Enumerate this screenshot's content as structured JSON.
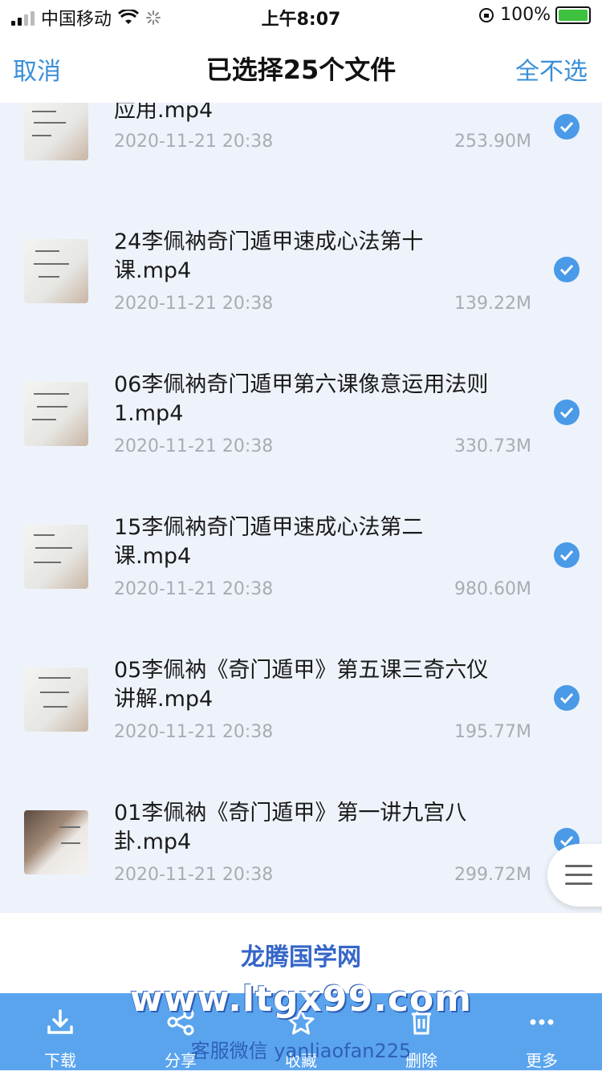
{
  "status": {
    "carrier": "中国移动",
    "time": "上午8:07",
    "battery": "100%"
  },
  "nav": {
    "cancel": "取消",
    "title": "已选择25个文件",
    "deselect_all": "全不选"
  },
  "files": [
    {
      "name": "应用.mp4",
      "date": "2020-11-21 20:38",
      "size": "253.90M",
      "checked": true
    },
    {
      "name": "24李佩衲奇门遁甲速成心法第十课.mp4",
      "date": "2020-11-21 20:38",
      "size": "139.22M",
      "checked": true
    },
    {
      "name": "06李佩衲奇门遁甲第六课像意运用法则1.mp4",
      "date": "2020-11-21 20:38",
      "size": "330.73M",
      "checked": true
    },
    {
      "name": "15李佩衲奇门遁甲速成心法第二课.mp4",
      "date": "2020-11-21 20:38",
      "size": "980.60M",
      "checked": true
    },
    {
      "name": "05李佩衲《奇门遁甲》第五课三奇六仪讲解.mp4",
      "date": "2020-11-21 20:38",
      "size": "195.77M",
      "checked": true
    },
    {
      "name": "01李佩衲《奇门遁甲》第一讲九宫八卦.mp4",
      "date": "2020-11-21 20:38",
      "size": "299.72M",
      "checked": true
    }
  ],
  "watermark": {
    "site_name": "龙腾国学网",
    "url": "www.ltgx99.com",
    "wechat": "客服微信 yanliaofan225"
  },
  "toolbar": {
    "download": "下载",
    "share": "分享",
    "favorite": "收藏",
    "delete": "删除",
    "more": "更多"
  },
  "colors": {
    "accent": "#3a8fd8",
    "toolbar": "#5aa4ee",
    "check": "#4a9ae8"
  }
}
